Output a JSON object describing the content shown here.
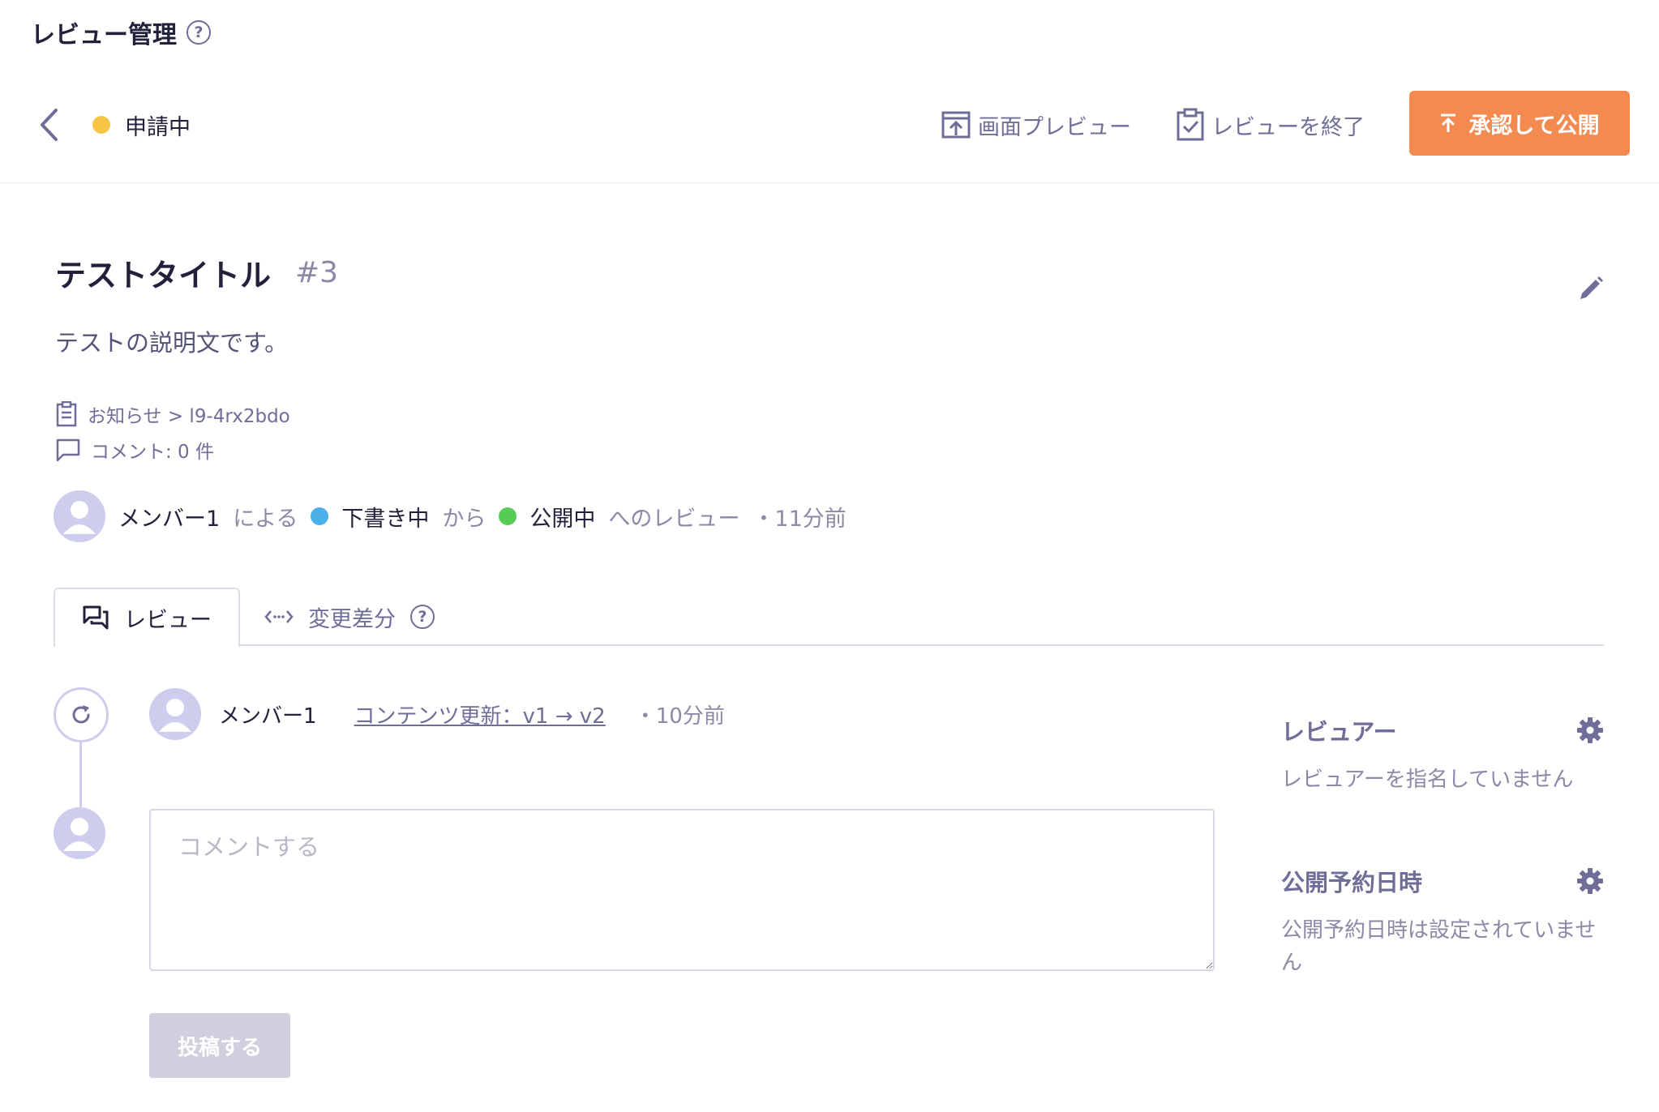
{
  "header": {
    "title": "レビュー管理",
    "help": "?"
  },
  "toolbar": {
    "status": "申請中",
    "preview_label": "画面プレビュー",
    "finish_label": "レビューを終了",
    "publish_label": "承認して公開"
  },
  "content": {
    "title": "テストタイトル",
    "number": "#3",
    "description": "テストの説明文です。",
    "path": "お知らせ > l9-4rx2bdo",
    "comments": "コメント: 0 件"
  },
  "byline": {
    "member": "メンバー1",
    "by": "による",
    "from_status": "下書き中",
    "from": "から",
    "to_status": "公開中",
    "to": "へのレビュー",
    "time": "・11分前"
  },
  "tabs": [
    {
      "label": "レビュー"
    },
    {
      "label": "変更差分"
    }
  ],
  "event": {
    "member": "メンバー1",
    "link": "コンテンツ更新：v1 → v2",
    "time": "・10分前"
  },
  "comment": {
    "placeholder": "コメントする",
    "submit_label": "投稿する"
  },
  "sidebar": {
    "reviewer_title": "レビュアー",
    "reviewer_text": "レビュアーを指名していません",
    "schedule_title": "公開予約日時",
    "schedule_text": "公開予約日時は設定されていません"
  },
  "colors": {
    "accent": "#f38a4f",
    "status_pending": "#f6c544",
    "status_draft": "#49b0ea",
    "status_published": "#56cc54",
    "muted": "#6e6e99"
  }
}
